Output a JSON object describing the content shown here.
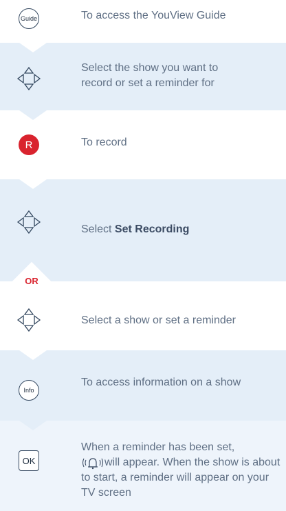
{
  "steps": [
    {
      "button": "Guide",
      "text": "To access the YouView Guide"
    },
    {
      "button": "nav",
      "text": "Select the show you want to record or set a reminder for"
    },
    {
      "button": "R",
      "text": "To record"
    },
    {
      "button": "nav",
      "text_prefix": "Select ",
      "text_bold": "Set Recording"
    },
    {
      "button": "nav",
      "text": "Select a show or set a reminder"
    },
    {
      "button": "Info",
      "text": "To access information on a show"
    },
    {
      "button": "OK",
      "text_before": "When a reminder has been set,",
      "text_after": "will appear. When the show is about to start, a reminder will appear on your TV screen"
    }
  ],
  "or_label": "OR",
  "colors": {
    "red": "#d9232e",
    "band_light": "#eef4fb",
    "band_mid": "#e4eef8",
    "text": "#5f6f84"
  }
}
